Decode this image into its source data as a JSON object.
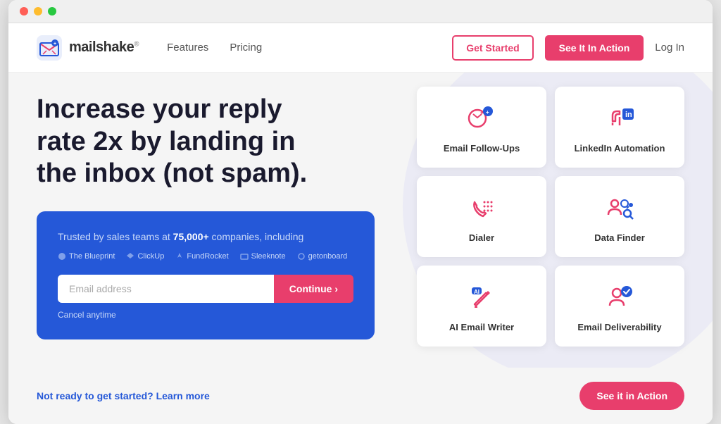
{
  "browser": {
    "traffic_lights": [
      "red",
      "yellow",
      "green"
    ]
  },
  "navbar": {
    "logo_text": "mailshake",
    "logo_superscript": "®",
    "nav_links": [
      {
        "label": "Features",
        "id": "features"
      },
      {
        "label": "Pricing",
        "id": "pricing"
      }
    ],
    "btn_get_started": "Get Started",
    "btn_see_action": "See It In Action",
    "btn_login": "Log In"
  },
  "hero": {
    "headline": "Increase your reply rate 2x by landing in the inbox (not spam).",
    "blue_card": {
      "trusted_text_before": "Trusted by sales teams at ",
      "trusted_highlight": "75,000+",
      "trusted_text_after": " companies, including",
      "companies": [
        {
          "name": "The Blueprint",
          "symbol": "🔵"
        },
        {
          "name": "ClickUp",
          "symbol": "⬆"
        },
        {
          "name": "FundRocket",
          "symbol": "🚀"
        },
        {
          "name": "Sleeknote",
          "symbol": "✉"
        },
        {
          "name": "getonboard",
          "symbol": "📋"
        }
      ],
      "email_placeholder": "Email address",
      "btn_continue": "Continue ›",
      "cancel_text": "Cancel anytime"
    }
  },
  "features": [
    {
      "id": "email-follow-ups",
      "label": "Email Follow-Ups",
      "icon": "email-followup"
    },
    {
      "id": "linkedin-automation",
      "label": "LinkedIn Automation",
      "icon": "linkedin"
    },
    {
      "id": "dialer",
      "label": "Dialer",
      "icon": "dialer"
    },
    {
      "id": "data-finder",
      "label": "Data Finder",
      "icon": "data-finder"
    },
    {
      "id": "ai-email-writer",
      "label": "AI Email Writer",
      "icon": "ai-writer"
    },
    {
      "id": "email-deliverability",
      "label": "Email Deliverability",
      "icon": "deliverability"
    }
  ],
  "footer": {
    "learn_more_text": "Not ready to get started? Learn more",
    "btn_see_action": "See it in Action"
  },
  "colors": {
    "primary_blue": "#2558d8",
    "primary_pink": "#e83e6c",
    "text_dark": "#1a1a2e",
    "text_muted": "#555",
    "bg_light": "#f5f5f5"
  }
}
